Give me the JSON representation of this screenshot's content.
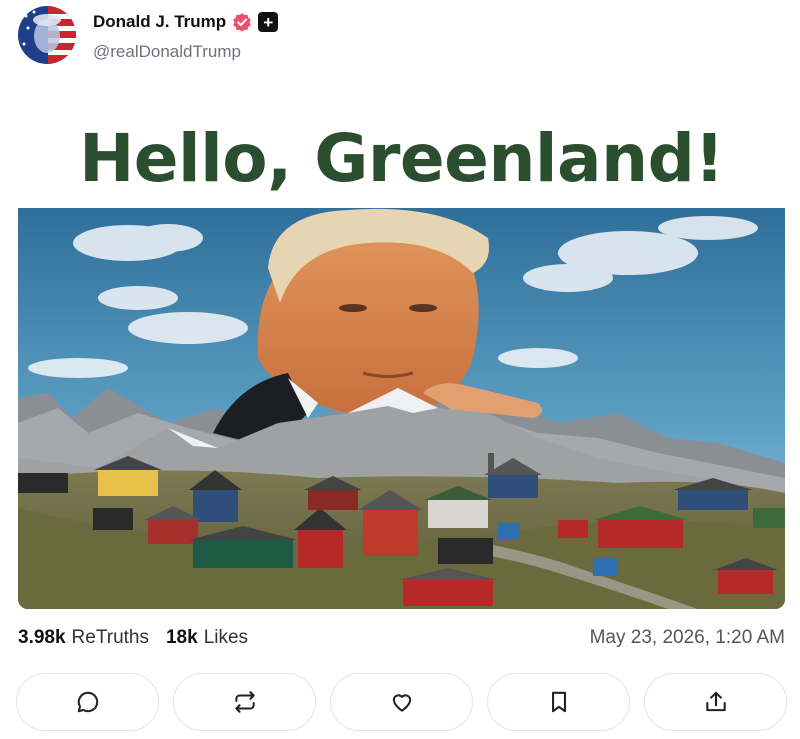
{
  "author": {
    "display_name": "Donald J. Trump",
    "handle": "@realDonaldTrump",
    "avatar_icon": "flag-portrait-avatar",
    "verified_icon": "verified-badge-icon",
    "verified_color": "#f0506e",
    "extra_badge_icon": "plus-badge-icon"
  },
  "post": {
    "image_headline": "Hello, Greenland!",
    "headline_color": "#2a4e2e"
  },
  "stats": {
    "retruths_count": "3.98k",
    "retruths_label": "ReTruths",
    "likes_count": "18k",
    "likes_label": "Likes",
    "timestamp": "May 23, 2026, 1:20 AM"
  },
  "actions": [
    {
      "name": "reply",
      "icon": "comment-icon"
    },
    {
      "name": "retruth",
      "icon": "repost-icon"
    },
    {
      "name": "like",
      "icon": "heart-icon"
    },
    {
      "name": "bookmark",
      "icon": "bookmark-icon"
    },
    {
      "name": "share",
      "icon": "share-icon"
    }
  ]
}
